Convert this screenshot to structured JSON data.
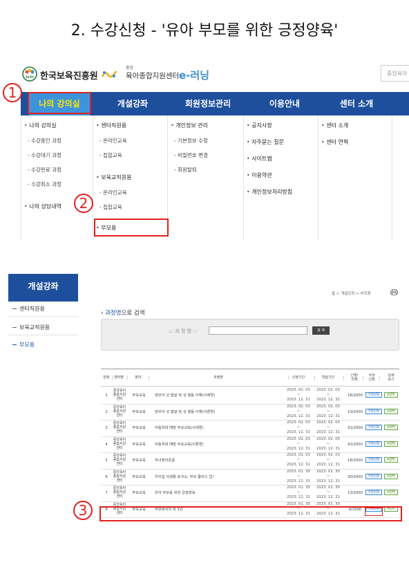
{
  "title": "2. 수강신청 - '유아 부모를 위한 긍정양육'",
  "header": {
    "org_name": "한국보육진흥원",
    "center_small": "중앙",
    "center_name": "육아종합지원센터",
    "center_brand": "e-러닝",
    "search_placeholder": "중앙육아"
  },
  "nav": {
    "items": [
      "나의 강의실",
      "개설강좌",
      "회원정보관리",
      "이용안내",
      "센터 소개"
    ],
    "active_index": 0
  },
  "mega_menu": {
    "col1": {
      "title": "나의 강의실",
      "subs": [
        "수강중인 과정",
        "수강대기 과정",
        "수강완료 과정",
        "수강취소 과정"
      ],
      "extra": "나의 상담내역"
    },
    "col2": {
      "group1": "센터직원용",
      "group1_subs": [
        "온라인교육",
        "집합교육"
      ],
      "group2": "보육교직원용",
      "group2_subs": [
        "온라인교육",
        "집합교육"
      ],
      "group3": "부모용"
    },
    "col3": {
      "title": "개인정보 관리",
      "subs": [
        "기본정보 수정",
        "비밀번호 변경",
        "회원탈퇴"
      ]
    },
    "col4": {
      "items": [
        "공지사항",
        "자주묻는 질문",
        "사이트맵",
        "이용약관",
        "개인정보처리방침"
      ]
    },
    "col5": {
      "items": [
        "센터 소개",
        "센터 연혁"
      ]
    }
  },
  "steps": [
    "1",
    "2",
    "3"
  ],
  "sidebar": {
    "heading": "개설강좌",
    "items": [
      "센터직원용",
      "보육교직원용",
      "부모용"
    ],
    "current_index": 2
  },
  "breadcrumb": "홈 > 개설강좌 > 부모용",
  "search": {
    "title_strong": "과정명",
    "title_rest": "으로 검색",
    "label": "::: 과 정 명 :::",
    "input_value": "",
    "button": "검 색"
  },
  "table": {
    "headers": [
      "번호",
      "센터명",
      "분야",
      "과정명",
      "신청기간",
      "학습기간",
      "신청/\n전체",
      "수강\n신청",
      "상세\n보기"
    ],
    "rows": [
      {
        "no": "1",
        "center": "중앙육아\n종합지원\n센터",
        "field": "부모교육",
        "course": "영유아 성 발달 및 성 행동 이해(사례편)",
        "apply": "2023. 02. 03\n~\n2023. 12. 31",
        "study": "2023. 02. 03\n~\n2023. 12. 31",
        "count": "18/2000"
      },
      {
        "no": "2",
        "center": "중앙육아\n종합지원\n센터",
        "field": "부모교육",
        "course": "영유아 성 발달 및 성 행동 이해(이론편)",
        "apply": "2023. 02. 03\n~\n2023. 12. 31",
        "study": "2023. 02. 03\n~\n2023. 12. 31",
        "count": "10/2000"
      },
      {
        "no": "3",
        "center": "중앙육아\n종합지원\n센터",
        "field": "부모교육",
        "course": "아동학대 예방 부모교육(사례편)",
        "apply": "2023. 02. 03\n~\n2023. 12. 31",
        "study": "2023. 02. 03\n~\n2023. 12. 31",
        "count": "31/2000"
      },
      {
        "no": "4",
        "center": "중앙육아\n종합지원\n센터",
        "field": "부모교육",
        "course": "아동학대 예방 부모교육(이론편)",
        "apply": "2023. 02. 03\n~\n2023. 12. 31",
        "study": "2023. 02. 03\n~\n2023. 12. 31",
        "count": "41/2000"
      },
      {
        "no": "5",
        "center": "중앙육아\n종합지원\n센터",
        "field": "부모교육",
        "course": "자녀권리존중",
        "apply": "2023. 02. 03\n~\n2023. 12. 31",
        "study": "2023. 02. 03\n~\n2023. 12. 31",
        "count": "18/2000"
      },
      {
        "no": "6",
        "center": "중앙육아\n종합지원\n센터",
        "field": "부모교육",
        "course": "우리집 식생활 토크쇼, 부모 클라스 업!",
        "apply": "2023. 01. 30\n~\n2023. 12. 31",
        "study": "2023. 01. 30\n~\n2023. 12. 31",
        "count": "30/2000"
      },
      {
        "no": "7",
        "center": "중앙육아\n종합지원\n센터",
        "field": "부모교육",
        "course": "유아 부모를 위한 긍정양육",
        "apply": "2023. 01. 30\n~\n2023. 12. 31",
        "study": "2023. 01. 30\n~\n2023. 12. 31",
        "count": "13/2000"
      },
      {
        "no": "8",
        "center": "중앙육아\n종합지원\n센터",
        "field": "부모교육",
        "course": "부모로서의 첫 1년",
        "apply": "2023. 01. 30\n~\n2023. 12. 31",
        "study": "2023. 01. 30\n~\n2023. 12. 31",
        "count": "9/2000"
      }
    ],
    "apply_label": "수강신청",
    "detail_label": "상세"
  },
  "colors": {
    "nav_bg": "#1d4f9c",
    "nav_active_bg": "#3e94dc",
    "nav_active_text": "#ffe100",
    "highlight": "#e02020",
    "brand_blue": "#3a8fd0"
  }
}
